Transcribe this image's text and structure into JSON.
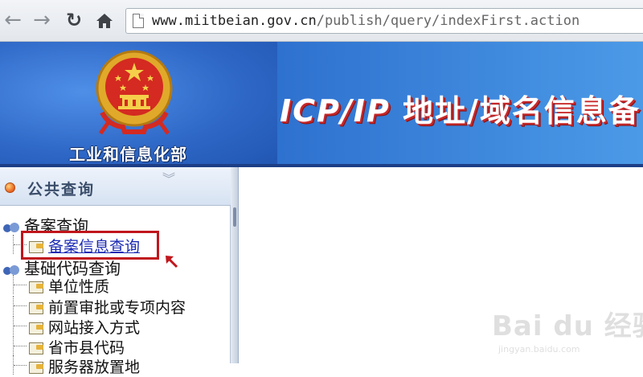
{
  "browser": {
    "url_host": "www.miitbeian.gov.cn",
    "url_path": "/publish/query/indexFirst.action"
  },
  "banner": {
    "ministry_name": "工业和信息化部",
    "title_latin": "ICP/IP",
    "title_zh": " 地址/域名信息备"
  },
  "sidebar": {
    "header": "公共查询",
    "tree": [
      {
        "label": "备案查询",
        "children": [
          {
            "label": "备案信息查询",
            "link": true
          }
        ]
      },
      {
        "label": "基础代码查询",
        "children": [
          {
            "label": "单位性质"
          },
          {
            "label": "前置审批或专项内容"
          },
          {
            "label": "网站接入方式"
          },
          {
            "label": "省市县代码"
          },
          {
            "label": "服务器放置地"
          }
        ]
      }
    ]
  },
  "colors": {
    "highlight": "#c0161c",
    "banner_blue": "#2c73d2",
    "title_shadow": "#c8282a"
  },
  "watermark": {
    "logo": "Bai du 经验",
    "sub": "jingyan.baidu.com"
  }
}
